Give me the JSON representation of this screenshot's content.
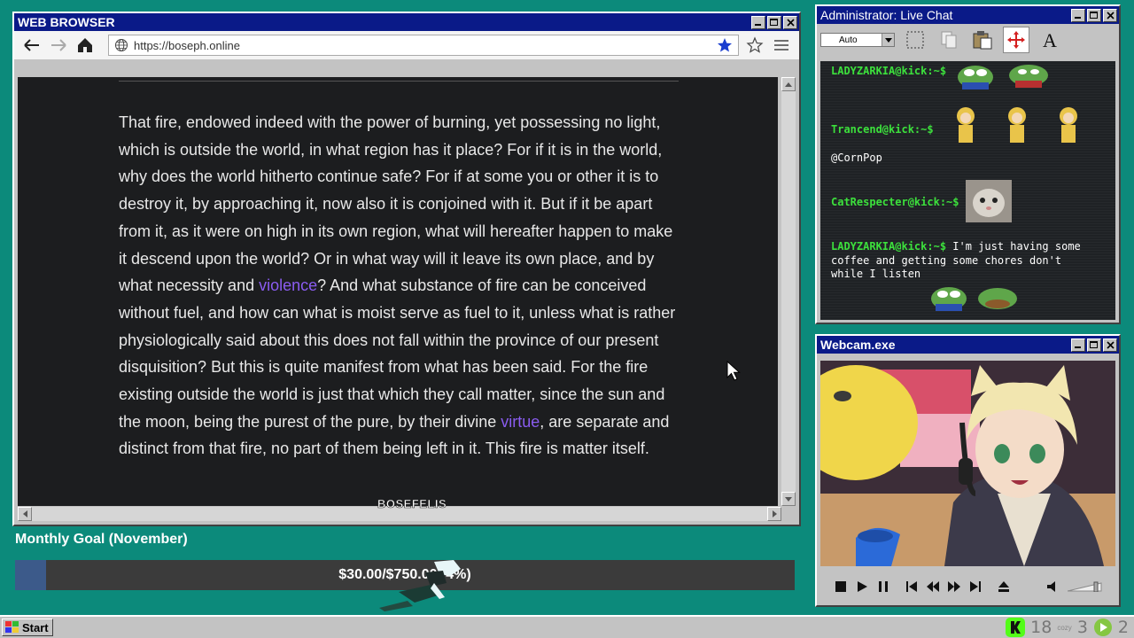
{
  "browser": {
    "title": "WEB BROWSER",
    "url": "https://boseph.online",
    "text": {
      "p1": "That fire, endowed indeed with the power of burning, yet possessing no light, which is outside the world, in what region has it place? For if it is in the world, why does the world hitherto continue safe? For if at some you or other it is to destroy it, by approaching it, now also it is conjoined with it. But if it be apart from it, as it were on high in its own region, what will hereafter happen to make it descend upon the world? Or in what way will it leave its own place, and by what necessity and ",
      "link1": "violence",
      "p2": "? And what substance of fire can be conceived without fuel, and how can what is moist serve as fuel to it, unless what is rather physiologically said about this does not fall within the province of our present disquisition? But this is quite manifest from what has been said. For the fire existing outside the world is just that which they call matter, since the sun and the moon, being the purest of the pure, by their divine ",
      "link2": "virtue",
      "p3": ", are separate and distinct from that fire, no part of them being left in it. This fire is matter itself."
    }
  },
  "watermark": "BOSEFELIS",
  "goal": {
    "label": "Monthly Goal (November)",
    "text": "$30.00/$750.00 (4%)",
    "fraction": 0.04
  },
  "chat": {
    "title": "Administrator: Live Chat",
    "select_value": "Auto",
    "messages": [
      {
        "user": "LADYZARKIA@kick:~$",
        "text": ""
      },
      {
        "user": "Trancend@kick:~$",
        "text": ""
      },
      {
        "user": "",
        "text": "@CornPop"
      },
      {
        "user": "CatRespecter@kick:~$",
        "text": ""
      },
      {
        "user": "LADYZARKIA@kick:~$",
        "text": "I'm just having some coffee and getting some chores don't while I listen"
      }
    ]
  },
  "webcam": {
    "title": "Webcam.exe"
  },
  "taskbar": {
    "start_label": "Start",
    "counts": [
      "18",
      "3",
      "2"
    ],
    "cozy": "cozy"
  },
  "colors": {
    "desktop": "#0c8a7b",
    "titlebar": "#0a1a88",
    "chat_user": "#3ce03c",
    "link": "#8a5cf0"
  }
}
